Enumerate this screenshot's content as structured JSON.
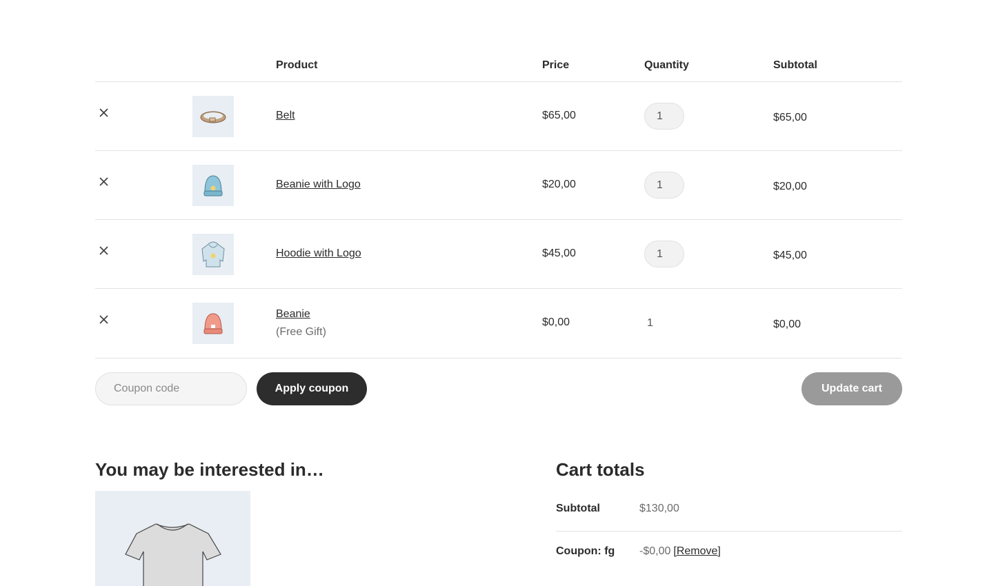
{
  "table": {
    "headers": {
      "product": "Product",
      "price": "Price",
      "quantity": "Quantity",
      "subtotal": "Subtotal"
    },
    "rows": [
      {
        "name": "Belt",
        "price": "$65,00",
        "quantity": "1",
        "subtotal": "$65,00",
        "thumb": "belt"
      },
      {
        "name": "Beanie with Logo",
        "price": "$20,00",
        "quantity": "1",
        "subtotal": "$20,00",
        "thumb": "beanie-logo"
      },
      {
        "name": "Hoodie with Logo",
        "price": "$45,00",
        "quantity": "1",
        "subtotal": "$45,00",
        "thumb": "hoodie"
      },
      {
        "name": "Beanie",
        "note": "(Free Gift)",
        "price": "$0,00",
        "quantity": "1",
        "subtotal": "$0,00",
        "thumb": "beanie"
      }
    ]
  },
  "actions": {
    "coupon_placeholder": "Coupon code",
    "apply_label": "Apply coupon",
    "update_label": "Update cart"
  },
  "cross_sells": {
    "title": "You may be interested in…",
    "image": "tshirt"
  },
  "totals": {
    "title": "Cart totals",
    "subtotal_label": "Subtotal",
    "subtotal_value": "$130,00",
    "coupon_label": "Coupon: fg",
    "coupon_value": "-$0,00",
    "remove_label": "[Remove]"
  },
  "colors": {
    "thumb_bg": "#e8eef3",
    "apply_bg": "#2d2d2d",
    "update_bg": "#9a9a9a"
  }
}
